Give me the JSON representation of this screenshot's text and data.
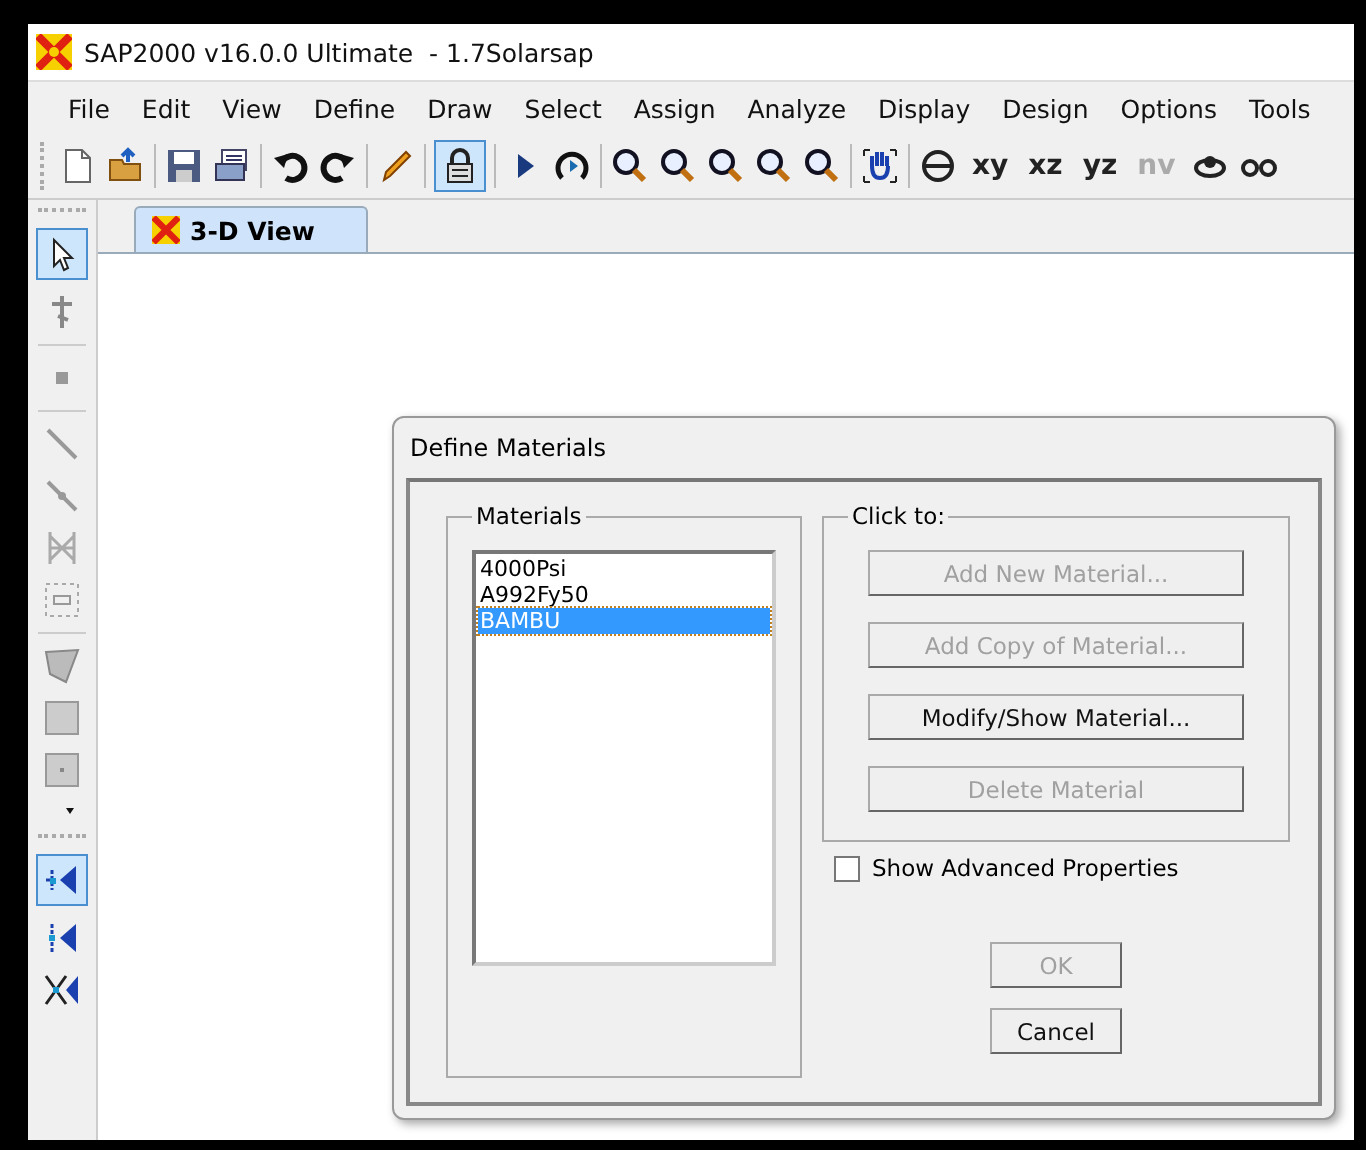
{
  "window": {
    "title": "SAP2000 v16.0.0 Ultimate  - 1.7Solarsap"
  },
  "menu": [
    "File",
    "Edit",
    "View",
    "Define",
    "Draw",
    "Select",
    "Assign",
    "Analyze",
    "Display",
    "Design",
    "Options",
    "Tools"
  ],
  "toolbar": {
    "lock_pressed": true,
    "view_buttons": [
      {
        "label": "xy",
        "disabled": false
      },
      {
        "label": "xz",
        "disabled": false
      },
      {
        "label": "yz",
        "disabled": false
      },
      {
        "label": "nv",
        "disabled": true
      }
    ]
  },
  "left_toolbar": {
    "pointer_pressed": true,
    "snap_pressed": true
  },
  "tabs": [
    {
      "label": "3-D View",
      "selected": true
    }
  ],
  "dialog": {
    "title": "Define Materials",
    "materials": {
      "label": "Materials",
      "items": [
        {
          "name": "4000Psi",
          "selected": false
        },
        {
          "name": "A992Fy50",
          "selected": false
        },
        {
          "name": "BAMBU",
          "selected": true
        }
      ]
    },
    "click_to": {
      "label": "Click to:",
      "buttons": [
        {
          "label": "Add New Material...",
          "disabled": true
        },
        {
          "label": "Add Copy of Material...",
          "disabled": true
        },
        {
          "label": "Modify/Show Material...",
          "disabled": false
        },
        {
          "label": "Delete Material",
          "disabled": true
        }
      ]
    },
    "show_advanced": {
      "label": "Show Advanced Properties",
      "checked": false
    },
    "ok": {
      "label": "OK",
      "disabled": true
    },
    "cancel": {
      "label": "Cancel",
      "disabled": false
    }
  }
}
